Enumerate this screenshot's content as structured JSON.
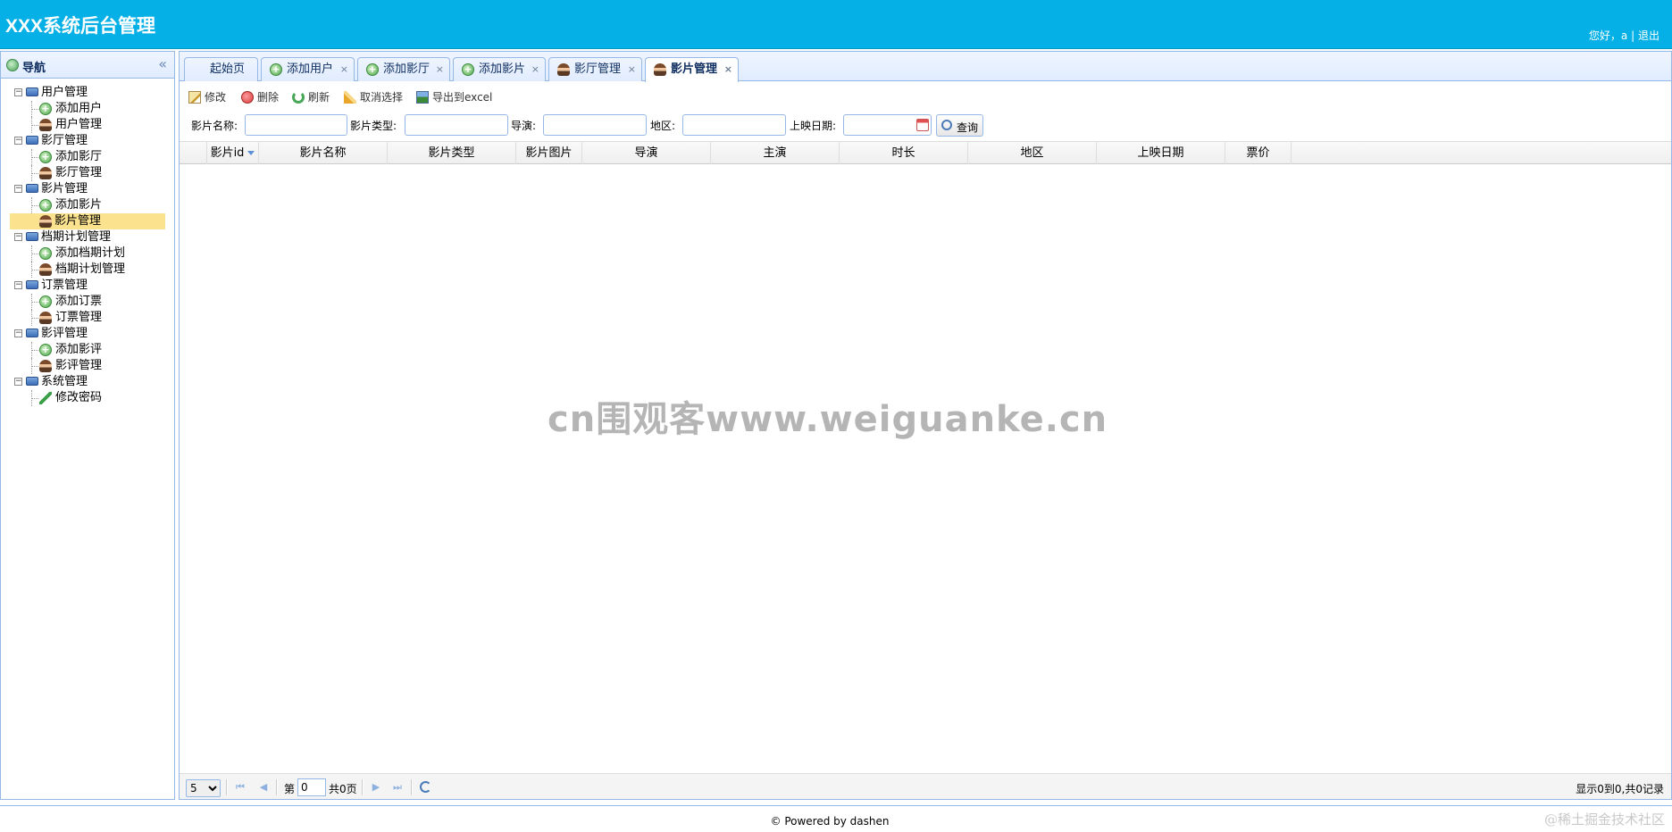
{
  "header": {
    "title": "XXX系统后台管理",
    "greeting": "您好，a",
    "separator": "|",
    "logout": "退出",
    "bg_color": "#04b0e6"
  },
  "nav": {
    "title": "导航",
    "collapse_glyph": "«",
    "tree": [
      {
        "label": "用户管理",
        "icon": "monitor-icon",
        "children": [
          {
            "label": "添加用户",
            "icon": "add-icon"
          },
          {
            "label": "用户管理",
            "icon": "user-icon"
          }
        ]
      },
      {
        "label": "影厅管理",
        "icon": "monitor-icon",
        "children": [
          {
            "label": "添加影厅",
            "icon": "add-icon"
          },
          {
            "label": "影厅管理",
            "icon": "user-icon"
          }
        ]
      },
      {
        "label": "影片管理",
        "icon": "monitor-icon",
        "children": [
          {
            "label": "添加影片",
            "icon": "add-icon"
          },
          {
            "label": "影片管理",
            "icon": "user-icon",
            "selected": true
          }
        ]
      },
      {
        "label": "档期计划管理",
        "icon": "monitor-icon",
        "children": [
          {
            "label": "添加档期计划",
            "icon": "add-icon"
          },
          {
            "label": "档期计划管理",
            "icon": "user-icon"
          }
        ]
      },
      {
        "label": "订票管理",
        "icon": "monitor-icon",
        "children": [
          {
            "label": "添加订票",
            "icon": "add-icon"
          },
          {
            "label": "订票管理",
            "icon": "user-icon"
          }
        ]
      },
      {
        "label": "影评管理",
        "icon": "monitor-icon",
        "children": [
          {
            "label": "添加影评",
            "icon": "add-icon"
          },
          {
            "label": "影评管理",
            "icon": "user-icon"
          }
        ]
      },
      {
        "label": "系统管理",
        "icon": "monitor-icon",
        "children": [
          {
            "label": "修改密码",
            "icon": "pencil-icon"
          }
        ]
      }
    ]
  },
  "tabs": [
    {
      "label": "起始页",
      "icon": "",
      "closable": false
    },
    {
      "label": "添加用户",
      "icon": "add-icon",
      "closable": true
    },
    {
      "label": "添加影厅",
      "icon": "add-icon",
      "closable": true
    },
    {
      "label": "添加影片",
      "icon": "add-icon",
      "closable": true
    },
    {
      "label": "影厅管理",
      "icon": "user-icon",
      "closable": true
    },
    {
      "label": "影片管理",
      "icon": "user-icon",
      "closable": true,
      "active": true
    }
  ],
  "tab_close_glyph": "×",
  "toolbar": {
    "edit": "修改",
    "delete": "删除",
    "refresh": "刷新",
    "cancel_select": "取消选择",
    "export": "导出到excel"
  },
  "search": {
    "film_name_label": "影片名称:",
    "film_type_label": "影片类型:",
    "director_label": "导演:",
    "region_label": "地区:",
    "release_date_label": "上映日期:",
    "film_name_value": "",
    "film_type_value": "",
    "director_value": "",
    "region_value": "",
    "release_date_value": "",
    "query_button": "查询"
  },
  "grid": {
    "columns": [
      "影片id",
      "影片名称",
      "影片类型",
      "影片图片",
      "导演",
      "主演",
      "时长",
      "地区",
      "上映日期",
      "票价"
    ],
    "rows": []
  },
  "watermark": "cn围观客www.weiguanke.cn",
  "pager": {
    "page_size": "5",
    "page_size_options": [
      "5"
    ],
    "page_prefix": "第",
    "page_value": "0",
    "page_total": "共0页",
    "info": "显示0到0,共0记录"
  },
  "footer": {
    "credits": "© Powered by dashen",
    "corner_mark": "@稀土掘金技术社区"
  }
}
